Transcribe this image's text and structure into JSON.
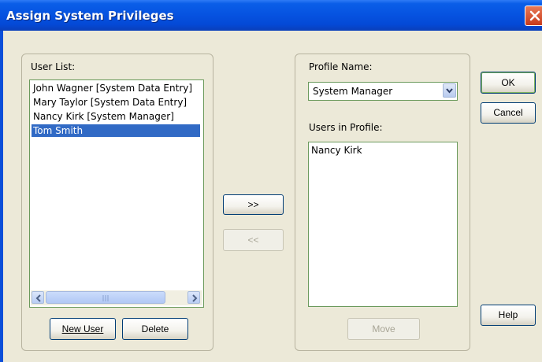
{
  "window": {
    "title": "Assign System Privileges"
  },
  "user_list": {
    "label": "User List:",
    "items": [
      "John Wagner [System Data Entry]",
      "Mary Taylor [System Data Entry]",
      "Nancy Kirk [System Manager]",
      "Tom Smith"
    ],
    "selected": "Tom Smith",
    "new_user_label": "New User",
    "delete_label": "Delete"
  },
  "transfer": {
    "add_label": ">>",
    "remove_label": "<<"
  },
  "profile": {
    "name_label": "Profile Name:",
    "selected_profile": "System Manager",
    "users_label": "Users in Profile:",
    "users": [
      "Nancy Kirk"
    ],
    "move_label": "Move"
  },
  "dialog_buttons": {
    "ok_label": "OK",
    "cancel_label": "Cancel",
    "help_label": "Help"
  },
  "colors": {
    "title_bar": "#0652e0",
    "selection": "#316ac5",
    "close_button": "#c8391a",
    "dialog_bg": "#ece9d8"
  }
}
